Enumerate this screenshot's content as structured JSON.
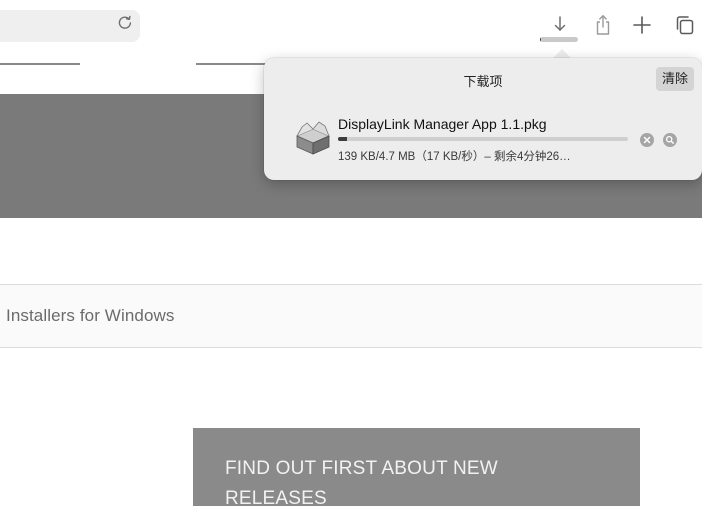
{
  "downloads": {
    "title": "下载项",
    "clear_label": "清除",
    "items": [
      {
        "file_name": "DisplayLink Manager App 1.1.pkg",
        "status": "139 KB/4.7 MB（17 KB/秒）– 剩余4分钟26…",
        "progress": 0.03,
        "icon": "package-icon"
      }
    ],
    "toolbar_progress": 0.03
  },
  "page": {
    "installers_title": "Installers for Windows",
    "signup_text": "FIND OUT FIRST ABOUT NEW RELEASES"
  },
  "toolbar": {
    "icons": [
      "reload-icon",
      "download-icon",
      "share-icon",
      "new-tab-icon",
      "tab-overview-icon"
    ]
  },
  "colors": {
    "band_gray": "#7a7a7a",
    "signup_gray": "#8a8a8a",
    "popover_bg": "#ededed"
  }
}
